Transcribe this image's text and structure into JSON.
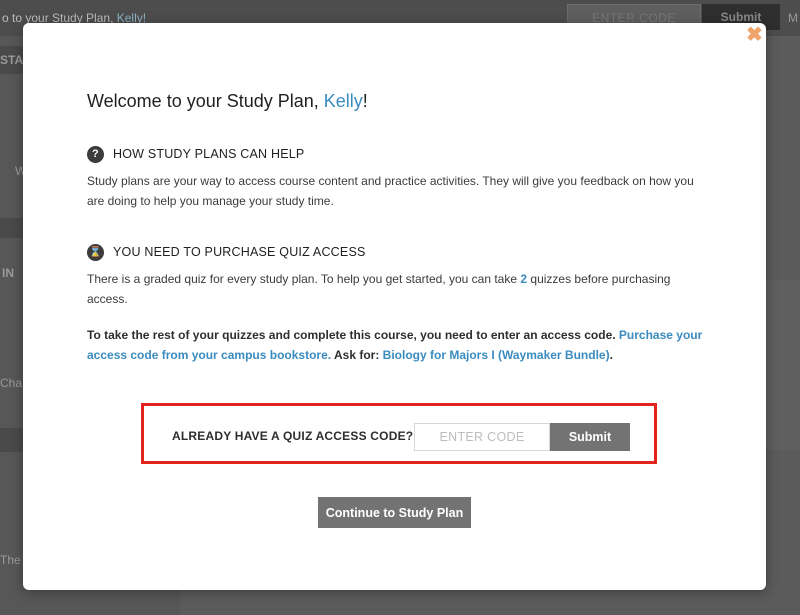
{
  "background": {
    "greeting_prefix": "o to your Study Plan,",
    "greeting_name": "Kelly!",
    "code_placeholder": "ENTER CODE",
    "submit_label": "Submit",
    "menu_letter": "M",
    "fragments": [
      "STA",
      "W",
      "IN",
      "Cha",
      "The"
    ]
  },
  "modal": {
    "close_icon": "close-icon",
    "title_prefix": "Welcome to your Study Plan, ",
    "title_name": "Kelly",
    "title_suffix": "!",
    "help": {
      "icon": "?",
      "heading": "HOW STUDY PLANS CAN HELP",
      "text": "Study plans are your way to access course content and practice activities. They will give you feedback on how you are doing to help you manage your study time."
    },
    "purchase": {
      "icon": "⌛",
      "heading": "YOU NEED TO PURCHASE QUIZ ACCESS",
      "text_before": "There is a graded quiz for every study plan. To help you get started, you can take ",
      "count": "2",
      "text_after": " quizzes before purchasing access.",
      "bold_text": "To take the rest of your quizzes and complete this course, you need to enter an access code. ",
      "link_text": "Purchase your access code from your campus bookstore.",
      "ask_text": " Ask for: ",
      "product_link": "Biology for Majors I (Waymaker Bundle)",
      "end": "."
    },
    "access_code": {
      "label": "ALREADY HAVE A QUIZ ACCESS CODE?",
      "placeholder": "ENTER CODE",
      "value": "",
      "submit_label": "Submit"
    },
    "continue_label": "Continue to Study Plan"
  },
  "colors": {
    "link": "#3a8bbf",
    "highlight_border": "#e3231c",
    "button": "#737373",
    "close": "#f0a36b"
  }
}
